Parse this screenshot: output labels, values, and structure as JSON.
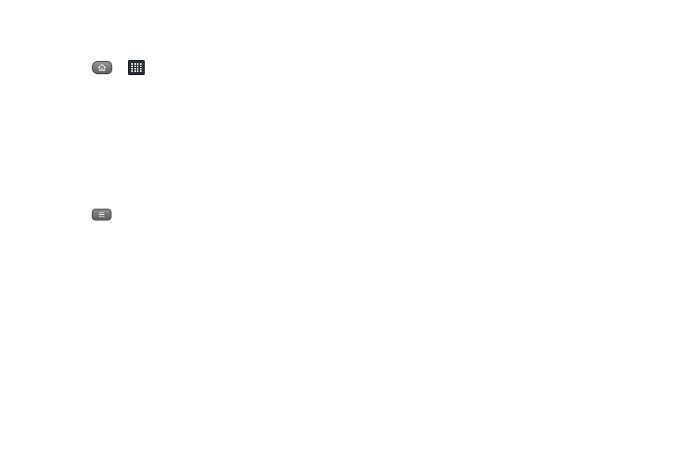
{
  "keys": {
    "home": {
      "icon": "home-icon"
    },
    "apps": {
      "icon": "apps-grid-icon"
    },
    "menu": {
      "icon": "menu-icon"
    }
  },
  "colors": {
    "key_gray": "#6f6f6f",
    "apps_bg": "#2d2f36",
    "glyph": "#f0f0f0"
  }
}
